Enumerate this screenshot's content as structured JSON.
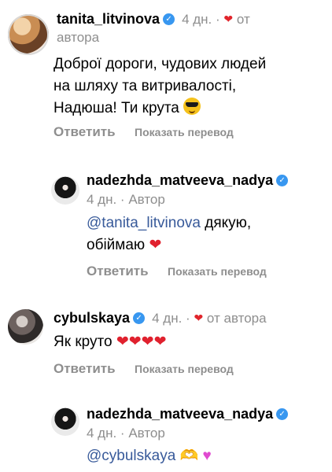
{
  "comments": [
    {
      "username": "tanita_litvinova",
      "meta_time": "4 дн.",
      "meta_sep": "·",
      "meta_liked": "от",
      "meta_liked_line2": "автора",
      "text_line1": "Доброї дороги, чудових людей",
      "text_line2": "на шляху та  витривалості,",
      "text_line3": "Надюша! Ти крута",
      "reply": "Ответить",
      "translate": "Показать перевод"
    },
    {
      "username": "nadezhda_matveeva_nadya",
      "meta": "4 дн. · Автор",
      "mention": "@tanita_litvinova",
      "text_rest": " дякую,",
      "text_line2": "обіймаю",
      "reply": "Ответить",
      "translate": "Показать перевод"
    },
    {
      "username": "cybulskaya",
      "meta_time": "4 дн.",
      "meta_sep": "·",
      "meta_liked": "от автора",
      "text": "Як круто",
      "reply": "Ответить",
      "translate": "Показать перевод"
    },
    {
      "username": "nadezhda_matveeva_nadya",
      "meta": "4 дн. · Автор",
      "mention": "@cybulskaya"
    }
  ],
  "icons": {
    "verified": "verified-badge-icon",
    "heart": "heart-icon"
  },
  "colors": {
    "verified": "#3897f0",
    "heart": "#e1252c",
    "mention": "#385a9a",
    "secondary": "#8e8e8e"
  }
}
